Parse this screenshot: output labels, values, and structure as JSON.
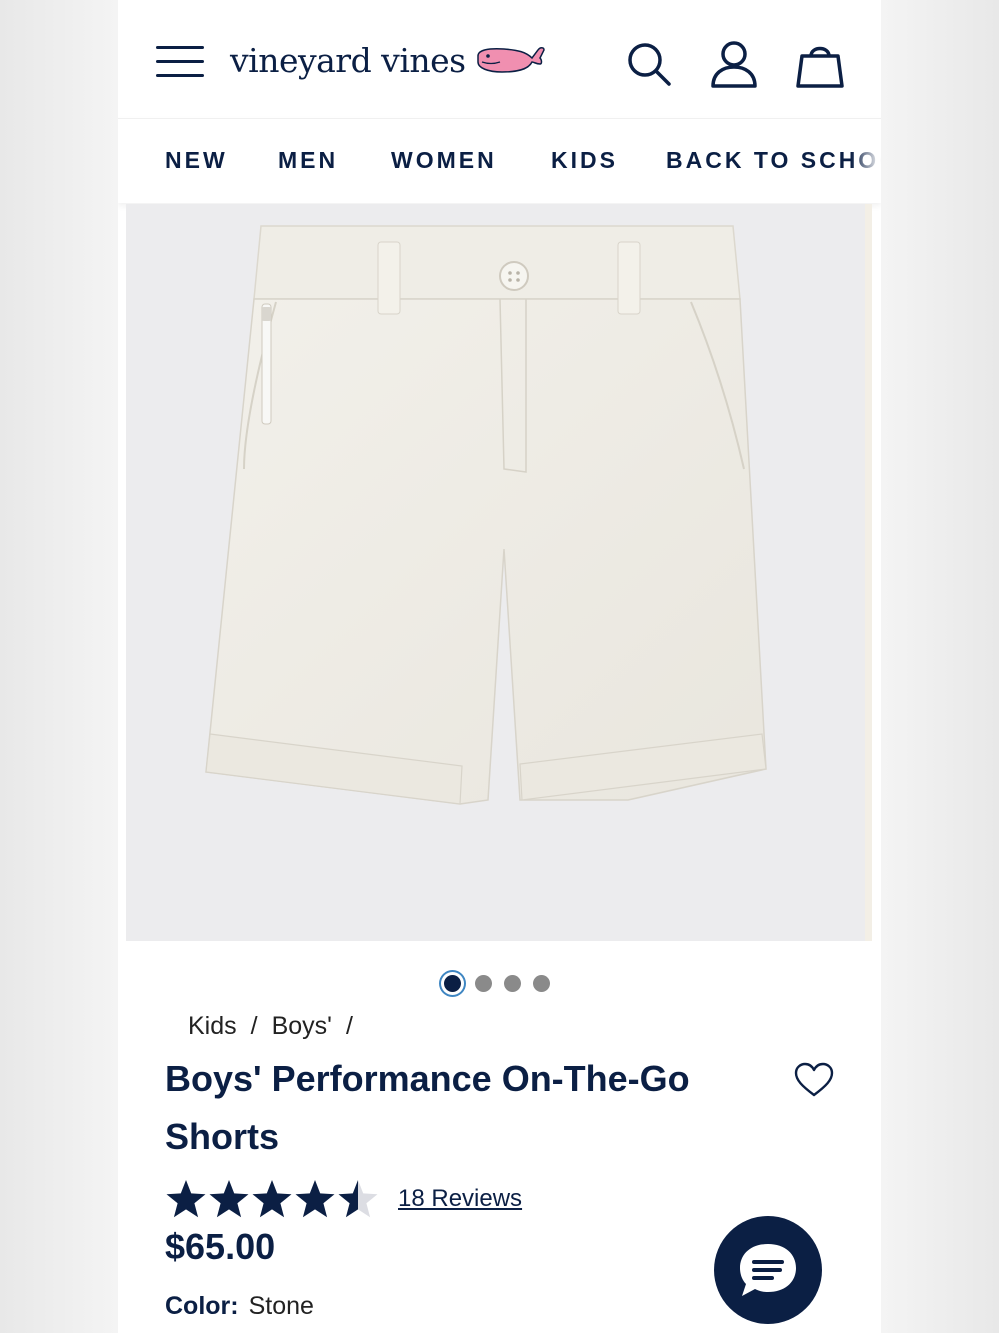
{
  "brand": {
    "name": "vineyard vines",
    "logo_color": "#0b1f44",
    "whale_color": "#f08fb0"
  },
  "header": {
    "menu_icon": "hamburger-icon",
    "search_icon": "search-icon",
    "account_icon": "user-icon",
    "bag_icon": "shopping-bag-icon"
  },
  "nav": {
    "items": [
      "NEW",
      "MEN",
      "WOMEN",
      "KIDS",
      "BACK TO SCHOOL"
    ]
  },
  "product": {
    "breadcrumb": [
      "Kids",
      "Boys'"
    ],
    "title": "Boys' Performance On-The-Go Shorts",
    "rating": 4.5,
    "rating_max": 5,
    "reviews_label": "18 Reviews",
    "price": "$65.00",
    "color_label": "Color:",
    "color_value": "Stone",
    "image_count": 4,
    "active_image": 1
  },
  "colors": {
    "navy": "#0b1f44",
    "background": "#ececee",
    "accent_ring": "#3f86c2"
  },
  "chat": {
    "icon": "chat-icon"
  }
}
